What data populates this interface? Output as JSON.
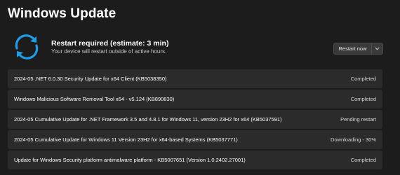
{
  "page": {
    "title": "Windows Update"
  },
  "status": {
    "icon": "restart-sync-icon",
    "title": "Restart required (estimate: 3 min)",
    "subtitle": "Your device will restart outside of active hours.",
    "restart_label": "Restart now",
    "more_icon": "chevron-down-icon"
  },
  "colors": {
    "background": "#1c1c1c",
    "row_background": "#2b2b2b",
    "accent": "#1e9de8"
  },
  "updates": [
    {
      "name": "2024-05 .NET 6.0.30 Security Update for x64 Client (KB5038350)",
      "status": "Completed"
    },
    {
      "name": "Windows Malicious Software Removal Tool x64 - v5.124 (KB890830)",
      "status": "Completed"
    },
    {
      "name": "2024-05 Cumulative Update for .NET Framework 3.5 and 4.8.1 for Windows 11, version 23H2 for x64 (KB5037591)",
      "status": "Pending restart"
    },
    {
      "name": "2024-05 Cumulative Update for Windows 11 Version 23H2 for x64-based Systems (KB5037771)",
      "status": "Downloading - 30%"
    },
    {
      "name": "Update for Windows Security platform antimalware platform - KB5007651 (Version 1.0.2402.27001)",
      "status": "Completed"
    }
  ]
}
